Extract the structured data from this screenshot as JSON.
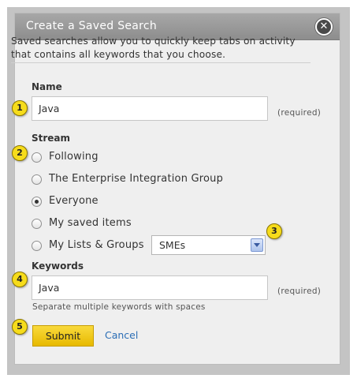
{
  "dialog": {
    "title": "Create a Saved Search",
    "close_icon": "close-icon",
    "description": "Saved searches allow you to quickly keep tabs on activity that contains all keywords that you choose."
  },
  "name_field": {
    "label": "Name",
    "value": "Java",
    "required_note": "(required)"
  },
  "stream": {
    "label": "Stream",
    "options": [
      {
        "label": "Following",
        "checked": false
      },
      {
        "label": "The Enterprise Integration Group",
        "checked": false
      },
      {
        "label": "Everyone",
        "checked": true
      },
      {
        "label": "My saved items",
        "checked": false
      },
      {
        "label": "My Lists & Groups",
        "checked": false
      }
    ],
    "lists_select_value": "SMEs"
  },
  "keywords_field": {
    "label": "Keywords",
    "value": "Java",
    "required_note": "(required)",
    "hint": "Separate multiple keywords with spaces"
  },
  "actions": {
    "submit_label": "Submit",
    "cancel_label": "Cancel"
  },
  "callouts": [
    "1",
    "2",
    "3",
    "4",
    "5"
  ],
  "colors": {
    "titlebar": "#9a9a9a",
    "submit": "#f2c60e",
    "link": "#2a6db5",
    "callout": "#f6dc1b"
  }
}
